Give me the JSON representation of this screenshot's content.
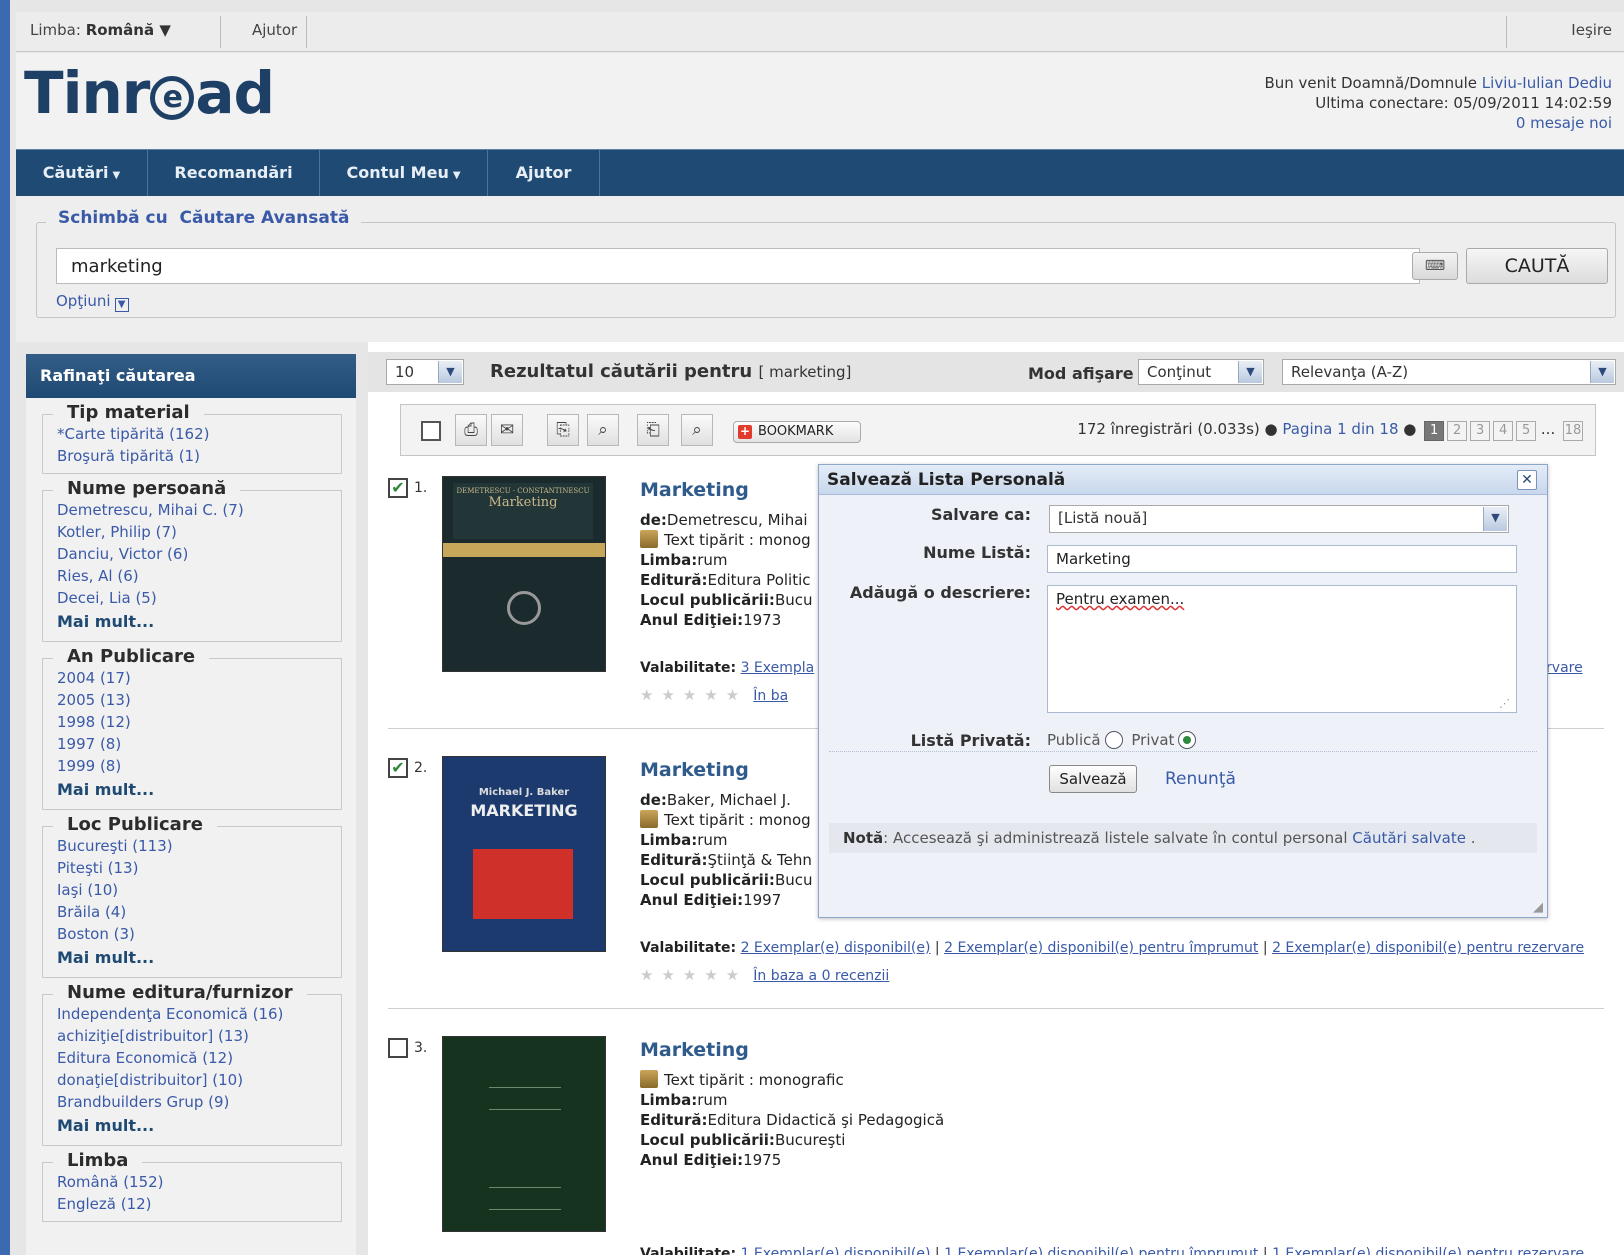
{
  "topbar": {
    "lang_prefix": "Limba:",
    "lang_value": "Română ▼",
    "help": "Ajutor",
    "exit": "Ieşire"
  },
  "header": {
    "logo": "Tinread",
    "welcome_prefix": "Bun venit Doamnă/Domnule",
    "user_name": "Liviu-Iulian Dediu",
    "last_login": "Ultima conectare: 05/09/2011 14:02:59",
    "messages": "0 mesaje noi"
  },
  "nav": {
    "searches": "Căutări",
    "recommendations": "Recomandări",
    "account": "Contul Meu",
    "help": "Ajutor"
  },
  "search": {
    "switch_label": "Schimbă cu",
    "advanced": "Căutare Avansată",
    "query": "marketing",
    "button": "CAUTĂ",
    "options": "Opţiuni"
  },
  "sidebar": {
    "title": "Rafinaţi căutarea",
    "facets": [
      {
        "name": "Tip material",
        "items": [
          "*Carte tipărită (162)",
          "Broşură tipărită (1)"
        ],
        "more": ""
      },
      {
        "name": "Nume persoană",
        "items": [
          "Demetrescu, Mihai C. (7)",
          "Kotler, Philip (7)",
          "Danciu, Victor (6)",
          "Ries, Al (6)",
          "Decei, Lia (5)"
        ],
        "more": "Mai mult..."
      },
      {
        "name": "An Publicare",
        "items": [
          "2004 (17)",
          "2005 (13)",
          "1998 (12)",
          "1997 (8)",
          "1999 (8)"
        ],
        "more": "Mai mult..."
      },
      {
        "name": "Loc Publicare",
        "items": [
          "Bucureşti (113)",
          "Piteşti (13)",
          "Iaşi (10)",
          "Brăila (4)",
          "Boston (3)"
        ],
        "more": "Mai mult..."
      },
      {
        "name": "Nume editura/furnizor",
        "items": [
          "Independenţa Economică (16)",
          "achiziţie[distribuitor] (13)",
          "Editura Economică (12)",
          "donaţie[distribuitor] (10)",
          "Brandbuilders Grup (9)"
        ],
        "more": "Mai mult..."
      },
      {
        "name": "Limba",
        "items": [
          "Română (152)",
          "Engleză (12)"
        ],
        "more": ""
      }
    ]
  },
  "results": {
    "per_page": "10",
    "title": "Rezultatul căutării pentru",
    "query_tag": "[ marketing]",
    "mode_label": "Mod afişare",
    "mode_value": "Conţinut",
    "sort_value": "Relevanţa (A-Z)",
    "bookmark": "BOOKMARK",
    "summary": "172 înregistrări (0.033s)",
    "page_info": "Pagina 1 din 18",
    "pages": [
      "1",
      "2",
      "3",
      "4",
      "5"
    ],
    "ellipsis": "...",
    "last_page": "18"
  },
  "records": [
    {
      "num": "1.",
      "checked": "✔",
      "title": "Marketing",
      "author_label": "de:",
      "author": "Demetrescu, Mihai",
      "type": "Text tipărit : monog",
      "lang_label": "Limba:",
      "lang": "rum",
      "pub_label": "Editură:",
      "pub": "Editura Politic",
      "place_label": "Locul publicării:",
      "place": "Bucu",
      "year_label": "Anul Ediţiei:",
      "year": "1973",
      "avail_label": "Valabilitate:",
      "avail": "3 Exempla",
      "avail_tail": "rezervare",
      "reviews": "În ba"
    },
    {
      "num": "2.",
      "checked": "✔",
      "title": "Marketing",
      "author_label": "de:",
      "author": "Baker, Michael J.",
      "type": "Text tipărit : monog",
      "lang_label": "Limba:",
      "lang": "rum",
      "pub_label": "Editură:",
      "pub": "Ştiinţă & Tehn",
      "place_label": "Locul publicării:",
      "place": "Bucu",
      "year_label": "Anul Ediţiei:",
      "year": "1997",
      "avail_label": "Valabilitate:",
      "avail1": "2 Exemplar(e) disponibil(e)",
      "avail2": "2 Exemplar(e) disponibil(e) pentru împrumut",
      "avail3": "2 Exemplar(e) disponibil(e) pentru rezervare",
      "reviews": "În baza a 0 recenzii"
    },
    {
      "num": "3.",
      "checked": "",
      "title": "Marketing",
      "type": "Text tipărit : monografic",
      "lang_label": "Limba:",
      "lang": "rum",
      "pub_label": "Editură:",
      "pub": "Editura Didactică şi Pedagogică",
      "place_label": "Locul publicării:",
      "place": "Bucureşti",
      "year_label": "Anul Ediţiei:",
      "year": "1975",
      "avail_label": "Valabilitate:",
      "avail1": "1 Exemplar(e) disponibil(e)",
      "avail2": "1 Exemplar(e) disponibil(e) pentru împrumut",
      "avail3": "1 Exemplar(e) disponibil(e) pentru rezervare"
    }
  ],
  "covers": [
    {
      "top_text": "Marketing",
      "small": "DEMETRESCU · CONSTANTINESCU",
      "bg": "#1b2a2c"
    },
    {
      "top_text": "MARKETING",
      "small": "Michael J. Baker",
      "bg": "#1c3a6e"
    },
    {
      "top_text": "",
      "small": "",
      "bg": "#15331f"
    }
  ],
  "modal": {
    "title": "Salvează Lista Personală",
    "save_as_label": "Salvare ca:",
    "save_as_value": "[Listă nouă]",
    "name_label": "Nume Listă:",
    "name_value": "Marketing",
    "desc_label": "Adăugă o descriere:",
    "desc_value": "Pentru examen...",
    "private_label": "Listă Privată:",
    "public_opt": "Publică",
    "private_opt": "Privat",
    "save_btn": "Salvează",
    "cancel": "Renunţă",
    "note_label": "Notă",
    "note_text": ": Accesează şi administrează listele salvate în contul personal",
    "note_link": "Căutări salvate",
    "note_end": " ."
  },
  "colors": {
    "nav": "#1f4a73",
    "link": "#3a5aa8",
    "title": "#2f5a8c",
    "check": "#2e8a3c"
  }
}
